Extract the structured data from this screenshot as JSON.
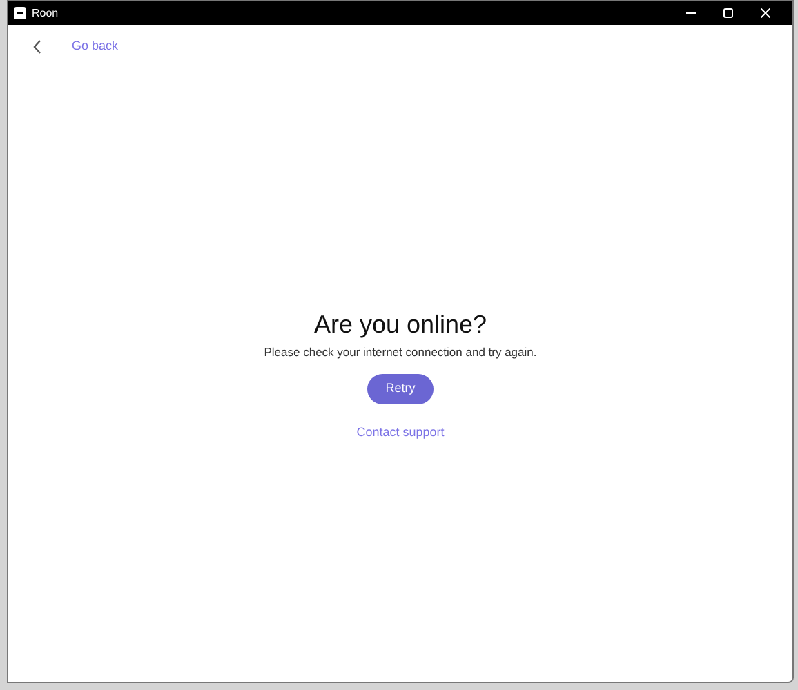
{
  "window": {
    "title": "Roon"
  },
  "back_link": {
    "label": "Go back"
  },
  "message": {
    "title": "Are you online?",
    "body": "Please check your internet connection and try again."
  },
  "buttons": [
    {
      "label": "Retry",
      "kind": "primary"
    },
    {
      "label": "Contact support",
      "kind": "link"
    }
  ]
}
